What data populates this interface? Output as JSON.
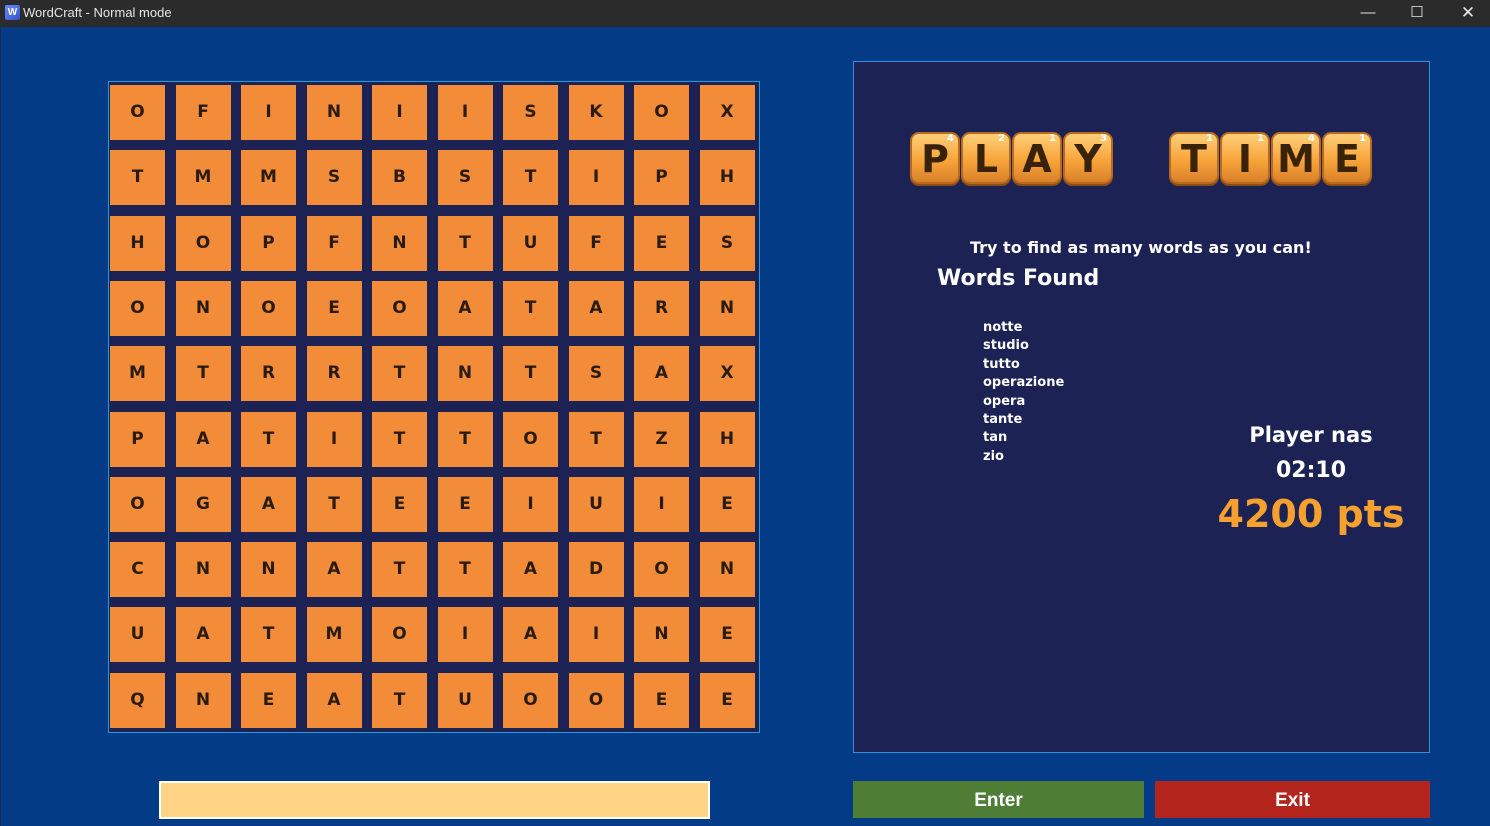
{
  "window": {
    "title": "WordCraft - Normal mode",
    "minimize_glyph": "—",
    "maximize_glyph": "☐",
    "close_glyph": "✕"
  },
  "board": {
    "rows": [
      [
        "O",
        "F",
        "I",
        "N",
        "I",
        "I",
        "S",
        "K",
        "O",
        "X"
      ],
      [
        "T",
        "M",
        "M",
        "S",
        "B",
        "S",
        "T",
        "I",
        "P",
        "H"
      ],
      [
        "H",
        "O",
        "P",
        "F",
        "N",
        "T",
        "U",
        "F",
        "E",
        "S"
      ],
      [
        "O",
        "N",
        "O",
        "E",
        "O",
        "A",
        "T",
        "A",
        "R",
        "N"
      ],
      [
        "M",
        "T",
        "R",
        "R",
        "T",
        "N",
        "T",
        "S",
        "A",
        "X"
      ],
      [
        "P",
        "A",
        "T",
        "I",
        "T",
        "T",
        "O",
        "T",
        "Z",
        "H"
      ],
      [
        "O",
        "G",
        "A",
        "T",
        "E",
        "E",
        "I",
        "U",
        "I",
        "E"
      ],
      [
        "C",
        "N",
        "N",
        "A",
        "T",
        "T",
        "A",
        "D",
        "O",
        "N"
      ],
      [
        "U",
        "A",
        "T",
        "M",
        "O",
        "I",
        "A",
        "I",
        "N",
        "E"
      ],
      [
        "Q",
        "N",
        "E",
        "A",
        "T",
        "U",
        "O",
        "O",
        "E",
        "E"
      ]
    ]
  },
  "input": {
    "value": "",
    "placeholder": ""
  },
  "panel": {
    "logo": {
      "play": [
        {
          "letter": "P",
          "num": "4"
        },
        {
          "letter": "L",
          "num": "2"
        },
        {
          "letter": "A",
          "num": "1"
        },
        {
          "letter": "Y",
          "num": "3"
        }
      ],
      "time": [
        {
          "letter": "T",
          "num": "1"
        },
        {
          "letter": "I",
          "num": "1"
        },
        {
          "letter": "M",
          "num": "4"
        },
        {
          "letter": "E",
          "num": "1"
        }
      ]
    },
    "instructions": "Try to find as many words as you can!",
    "words_found_title": "Words Found",
    "words_found": [
      "notte",
      "studio",
      "tutto",
      "operazione",
      "opera",
      "tante",
      "tan",
      "zio"
    ],
    "player_name": "Player nas",
    "timer": "02:10",
    "score": "4200 pts"
  },
  "buttons": {
    "enter": "Enter",
    "exit": "Exit"
  },
  "colors": {
    "background": "#043b86",
    "panel": "#1c2354",
    "tile": "#f28c38",
    "input": "#ffd585",
    "enter": "#4e7d36",
    "exit": "#b3241d",
    "score": "#f6a12f"
  }
}
